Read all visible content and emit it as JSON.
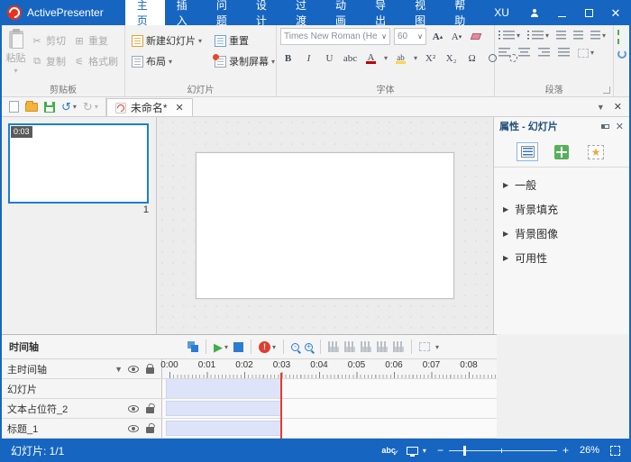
{
  "titlebar": {
    "app_name": "ActivePresenter",
    "tabs": [
      "主页",
      "插入",
      "问题",
      "设计",
      "过渡",
      "动画",
      "导出",
      "视图",
      "帮助",
      "XU"
    ],
    "active_tab": "主页",
    "close_glyph": "✕"
  },
  "ribbon": {
    "clipboard": {
      "label": "剪贴板",
      "paste": "粘贴",
      "cut": "剪切",
      "duplicate": "重复",
      "copy": "复制",
      "format_painter": "格式刷"
    },
    "slide": {
      "label": "幻灯片",
      "new_slide": "新建幻灯片",
      "reset": "重置",
      "layout": "布局",
      "record_screen": "录制屏幕"
    },
    "font": {
      "label": "字体",
      "family": "Times New Roman (He",
      "size": "60",
      "grow": "A",
      "shrink": "A",
      "bold": "B",
      "italic": "I",
      "underline": "U",
      "strike": "abc",
      "color_letter": "A",
      "highlight_letters": "ab",
      "superscript": "X²",
      "subscript": "X₂",
      "symbol": "Ω"
    },
    "paragraph": {
      "label": "段落"
    }
  },
  "docbar": {
    "tab_title": "未命名*",
    "tab_close": "✕",
    "panel_close": "✕"
  },
  "slides_panel": {
    "time_badge": "0:03",
    "slide_number": "1"
  },
  "properties": {
    "title": "属性 - 幻灯片",
    "close": "✕",
    "sections": [
      "一般",
      "背景填充",
      "背景图像",
      "可用性"
    ]
  },
  "timeline": {
    "title": "时间轴",
    "master_track": "主时间轴",
    "ruler": [
      "0:00",
      "0:01",
      "0:02",
      "0:03",
      "0:04",
      "0:05",
      "0:06",
      "0:07",
      "0:08"
    ],
    "rows": [
      "幻灯片",
      "文本占位符_2",
      "标题_1"
    ],
    "record_glyph": "!"
  },
  "statusbar": {
    "slide_info": "幻灯片: 1/1",
    "zoom_level": "26%",
    "spell_glyph": "abc"
  },
  "colors": {
    "accent": "#1666c1",
    "playhead": "#e8392b",
    "track_bar": "#dde3f8",
    "selection": "#1a7fd4"
  }
}
